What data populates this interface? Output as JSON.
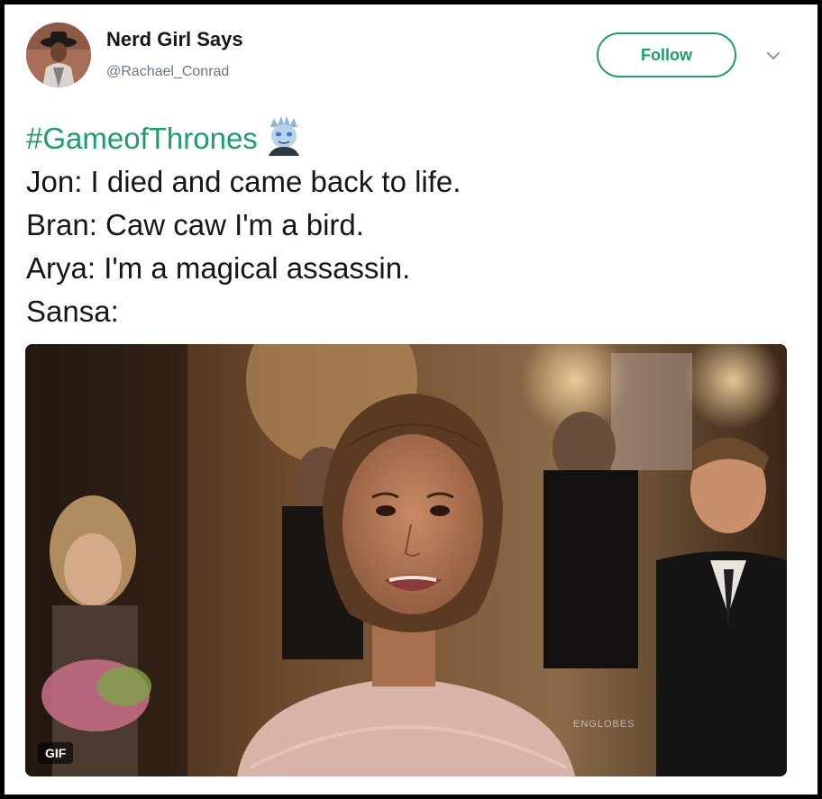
{
  "colors": {
    "accent": "#1b9e6e",
    "text": "#14171a",
    "muted": "#657786",
    "background": "#ffffff"
  },
  "tweet": {
    "author": {
      "name": "Nerd Girl Says",
      "handle": "@Rachael_Conrad"
    },
    "follow_label": "Follow",
    "menu_icon": "chevron-down-icon",
    "hashtag": "#GameofThrones",
    "emoji_icon": "night-king-icon",
    "lines": [
      "Jon: I died and came back to life.",
      "Bran: Caw caw I'm a bird.",
      "Arya: I'm a magical assassin.",
      "Sansa:"
    ],
    "media": {
      "badge": "GIF",
      "watermark": "ENGLOBES"
    }
  }
}
